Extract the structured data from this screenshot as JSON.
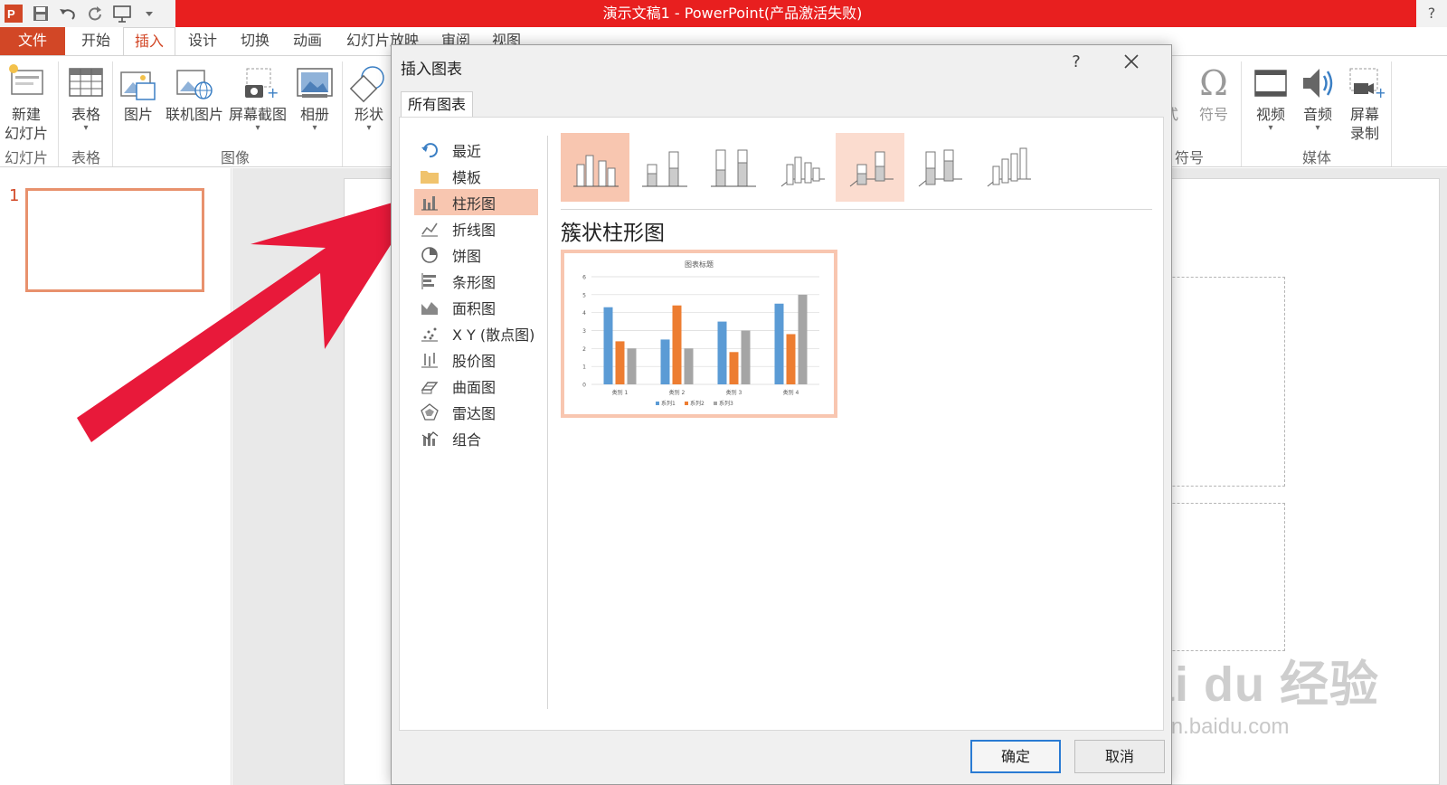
{
  "window": {
    "title": "演示文稿1 - PowerPoint(产品激活失败)",
    "help": "?"
  },
  "tabs": [
    {
      "label": "文件"
    },
    {
      "label": "开始"
    },
    {
      "label": "插入"
    },
    {
      "label": "设计"
    },
    {
      "label": "切换"
    },
    {
      "label": "动画"
    },
    {
      "label": "幻灯片放映"
    },
    {
      "label": "审阅"
    },
    {
      "label": "视图"
    }
  ],
  "ribbon": {
    "new_slide": {
      "line1": "新建",
      "line2": "幻灯片"
    },
    "table": "表格",
    "picture": "图片",
    "online_picture": "联机图片",
    "screenshot": "屏幕截图",
    "album": "相册",
    "shapes": "形状",
    "equation_fragment": "式",
    "symbol": "符号",
    "video": "视频",
    "audio": "音频",
    "screen_record": {
      "line1": "屏幕",
      "line2": "录制"
    },
    "groups": {
      "slides": "幻灯片",
      "tables": "表格",
      "images": "图像",
      "symbols": "符号",
      "media": "媒体"
    }
  },
  "thumbnail": {
    "number": "1"
  },
  "dialog": {
    "title": "插入图表",
    "help": "?",
    "tab": "所有图表",
    "categories": [
      {
        "label": "最近",
        "icon": "recent-icon"
      },
      {
        "label": "模板",
        "icon": "folder-icon"
      },
      {
        "label": "柱形图",
        "icon": "column-chart-icon"
      },
      {
        "label": "折线图",
        "icon": "line-chart-icon"
      },
      {
        "label": "饼图",
        "icon": "pie-chart-icon"
      },
      {
        "label": "条形图",
        "icon": "bar-chart-icon"
      },
      {
        "label": "面积图",
        "icon": "area-chart-icon"
      },
      {
        "label": "X Y (散点图)",
        "icon": "scatter-chart-icon"
      },
      {
        "label": "股价图",
        "icon": "stock-chart-icon"
      },
      {
        "label": "曲面图",
        "icon": "surface-chart-icon"
      },
      {
        "label": "雷达图",
        "icon": "radar-chart-icon"
      },
      {
        "label": "组合",
        "icon": "combo-chart-icon"
      }
    ],
    "selected_category": "柱形图",
    "chart_type_title": "簇状柱形图",
    "ok": "确定",
    "cancel": "取消",
    "colors": {
      "series1": "#5b9bd5",
      "series2": "#ed7d31",
      "series3": "#a5a5a5",
      "highlight": "#f8c6b0"
    }
  },
  "chart_data": {
    "type": "bar",
    "title": "图表标题",
    "categories": [
      "类别 1",
      "类别 2",
      "类别 3",
      "类别 4"
    ],
    "series": [
      {
        "name": "系列1",
        "values": [
          4.3,
          2.5,
          3.5,
          4.5
        ]
      },
      {
        "name": "系列2",
        "values": [
          2.4,
          4.4,
          1.8,
          2.8
        ]
      },
      {
        "name": "系列3",
        "values": [
          2,
          2,
          3,
          5
        ]
      }
    ],
    "ylim": [
      0,
      6
    ],
    "yticks": [
      0,
      1,
      2,
      3,
      4,
      5,
      6
    ],
    "legend": "bottom",
    "grid": true
  },
  "watermark": {
    "logo": "Bai du 经验",
    "url": "jingyan.baidu.com"
  }
}
